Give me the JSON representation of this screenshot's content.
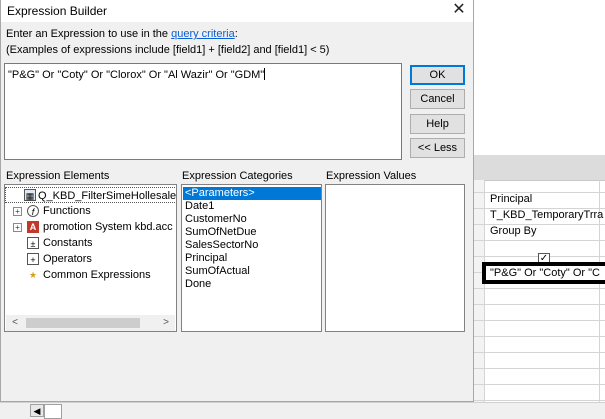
{
  "dialog": {
    "title": "Expression Builder",
    "close_glyph": "✕",
    "instruction_prefix": "Enter an Expression to use in the ",
    "instruction_link": "query criteria",
    "instruction_suffix": ":",
    "examples": "(Examples of expressions include [field1] + [field2] and [field1] < 5)",
    "expression": "\"P&G\" Or \"Coty\" Or \"Clorox\" Or \"Al Wazir\" Or \"GDM\"",
    "buttons": {
      "ok": "OK",
      "cancel": "Cancel",
      "help": "Help",
      "less": "<< Less"
    }
  },
  "elements": {
    "label": "Expression Elements",
    "items": [
      {
        "label": "Q_KBD_FilterSimeHollesale",
        "icon": "query-icon"
      },
      {
        "label": "Functions",
        "icon": "function-icon"
      },
      {
        "label": "promotion System kbd.acc",
        "icon": "database-icon"
      },
      {
        "label": "Constants",
        "icon": "constants-icon"
      },
      {
        "label": "Operators",
        "icon": "operators-icon"
      },
      {
        "label": "Common Expressions",
        "icon": "common-expressions-icon"
      }
    ]
  },
  "categories": {
    "label": "Expression Categories",
    "items": [
      "<Parameters>",
      "Date1",
      "CustomerNo",
      "SumOfNetDue",
      "SalesSectorNo",
      "Principal",
      "SumOfActual",
      "Done"
    ]
  },
  "values": {
    "label": "Expression Values"
  },
  "grid": {
    "field": "Principal",
    "table": "T_KBD_TemporaryTrra",
    "total": "Group By",
    "criteria": "\"P&G\" Or \"Coty\" Or \"C"
  },
  "colors": {
    "selection": "#0078d7",
    "link": "#0b5ed7",
    "dialog_bg": "#f0f0f0"
  }
}
